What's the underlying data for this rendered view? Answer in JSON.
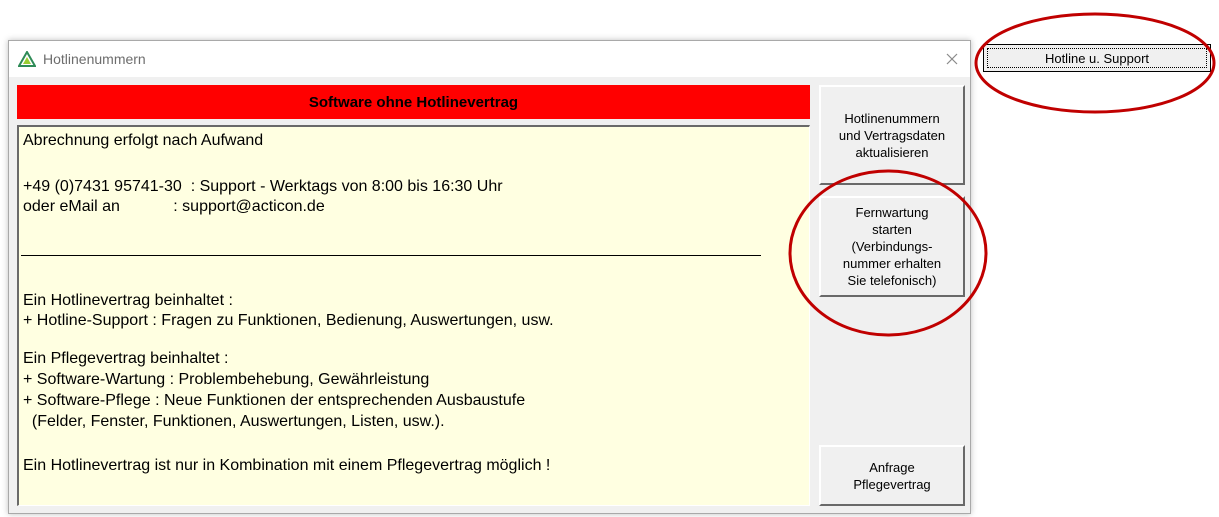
{
  "window": {
    "title": "Hotlinenummern",
    "banner": "Software ohne Hotlinevertrag",
    "info_lines": [
      "Abrechnung erfolgt nach Aufwand",
      "+49 (0)7431 95741-30  : Support - Werktags von 8:00 bis 16:30 Uhr",
      "oder eMail an            : support@acticon.de",
      "Ein Hotlinevertrag beinhaltet :",
      "+ Hotline-Support : Fragen zu Funktionen, Bedienung, Auswertungen, usw.",
      "Ein Pflegevertrag beinhaltet :",
      "+ Software-Wartung : Problembehebung, Gewährleistung",
      "+ Software-Pflege : Neue Funktionen der entsprechenden Ausbaustufe",
      "  (Felder, Fenster, Funktionen, Auswertungen, Listen, usw.).",
      "Ein Hotlinevertrag ist nur in Kombination mit einem Pflegevertrag möglich !"
    ],
    "buttons": {
      "update": "Hotlinenummern\nund Vertragsdaten\naktualisieren",
      "remote": "Fernwartung\nstarten\n(Verbindungs-\nnummer erhalten\nSie telefonisch)",
      "request": "Anfrage\nPflegevertrag"
    }
  },
  "external_button": "Hotline u. Support",
  "colors": {
    "banner": "#ff0000",
    "panel_bg": "#ffffe1",
    "annotation_circle": "#c00000"
  },
  "icons": [
    "recycle-logo-icon",
    "close-icon"
  ]
}
